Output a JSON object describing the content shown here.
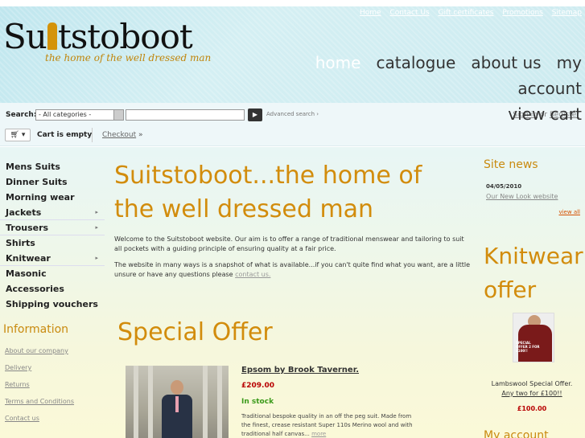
{
  "header": {
    "logo_text_left": "Su",
    "logo_text_right": "tstoboot",
    "tagline": "the home of the well dressed man",
    "top_links": [
      "Home",
      "Contact Us",
      "Gift certificates",
      "Promotions",
      "Sitemap"
    ],
    "nav": [
      "home",
      "catalogue",
      "about us",
      "my account",
      "view cart"
    ]
  },
  "search": {
    "label": "Search:",
    "category": "- All categories -",
    "advanced": "Advanced search ›",
    "sign_in": "Sign in",
    "or": "or",
    "register": "Register"
  },
  "cart": {
    "status": "Cart is empty",
    "checkout": "Checkout",
    "checkout_arrow": "»"
  },
  "categories": [
    {
      "label": "Mens Suits",
      "has_sub": false
    },
    {
      "label": "Dinner Suits",
      "has_sub": false
    },
    {
      "label": "Morning wear",
      "has_sub": false
    },
    {
      "label": "Jackets",
      "has_sub": true
    },
    {
      "label": "Trousers",
      "has_sub": true
    },
    {
      "label": "Shirts",
      "has_sub": false
    },
    {
      "label": "Knitwear",
      "has_sub": true
    },
    {
      "label": "Masonic",
      "has_sub": false
    },
    {
      "label": "Accessories",
      "has_sub": false
    },
    {
      "label": "Shipping vouchers",
      "has_sub": false
    }
  ],
  "information": {
    "title": "Information",
    "links": [
      "About our company",
      "Delivery",
      "Returns",
      "Terms and Conditions",
      "Contact us"
    ]
  },
  "main": {
    "title": "Suitstoboot...the home of the well dressed man",
    "intro1": "Welcome to the Suitstoboot website. Our aim is to offer a range of traditional menswear and tailoring to suit all pockets with a guiding principle of ensuring quality at a fair price.",
    "intro2_text": "The website in many ways is a snapshot of what is available...if you can't quite find what you want, are a little unsure or have any questions please",
    "intro2_link": "contact us.",
    "offer_title": "Special Offer"
  },
  "product": {
    "name": "Epsom by Brook Taverner.",
    "price": "£209.00",
    "stock": "In stock",
    "description": "Traditional bespoke quality in an off the peg suit. Made from the finest, crease resistant Super 110s Merino wool and with traditional half canvas...",
    "more": "more"
  },
  "news": {
    "title": "Site news",
    "date": "04/05/2010",
    "link": "Our New Look website",
    "view_all": "view all"
  },
  "knitwear": {
    "title": "Knitwear offer",
    "image_label": "SPECIAL OFFER 2 FOR £100!!",
    "caption": "Lambswool Special Offer.",
    "caption_link": "Any two for £100!!",
    "price": "£100.00"
  },
  "account": {
    "title": "My account"
  },
  "colors": {
    "accent": "#d28c0c",
    "price": "#b80000",
    "stock": "#3a9a1a",
    "header": "#c6e9ef"
  }
}
